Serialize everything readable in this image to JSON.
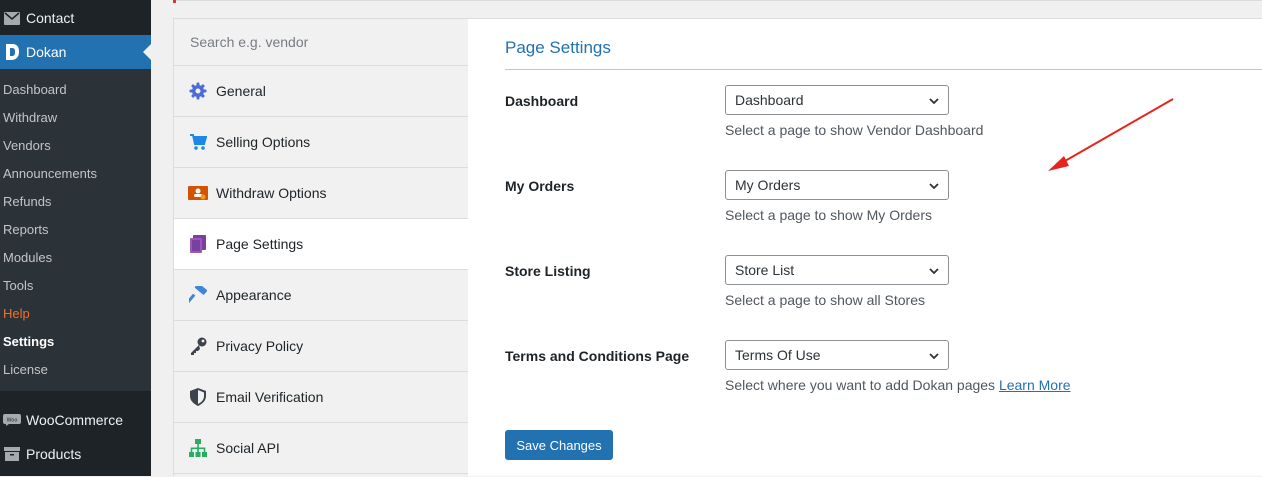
{
  "sidebar": {
    "contact": "Contact",
    "dokan": "Dokan",
    "submenu": [
      "Dashboard",
      "Withdraw",
      "Vendors",
      "Announcements",
      "Refunds",
      "Reports",
      "Modules",
      "Tools",
      "Help",
      "Settings",
      "License"
    ],
    "woocommerce": "WooCommerce",
    "products": "Products"
  },
  "tabs": {
    "search_placeholder": "Search e.g. vendor",
    "items": [
      {
        "label": "General",
        "icon": "gear-icon"
      },
      {
        "label": "Selling Options",
        "icon": "cart-icon"
      },
      {
        "label": "Withdraw Options",
        "icon": "withdraw-icon"
      },
      {
        "label": "Page Settings",
        "icon": "book-icon"
      },
      {
        "label": "Appearance",
        "icon": "hammer-icon"
      },
      {
        "label": "Privacy Policy",
        "icon": "key-icon"
      },
      {
        "label": "Email Verification",
        "icon": "shield-icon"
      },
      {
        "label": "Social API",
        "icon": "network-icon"
      }
    ],
    "active": "Page Settings"
  },
  "settings": {
    "title": "Page Settings",
    "rows": [
      {
        "label": "Dashboard",
        "value": "Dashboard",
        "desc": "Select a page to show Vendor Dashboard"
      },
      {
        "label": "My Orders",
        "value": "My Orders",
        "desc": "Select a page to show My Orders"
      },
      {
        "label": "Store Listing",
        "value": "Store List",
        "desc": "Select a page to show all Stores"
      },
      {
        "label": "Terms and Conditions Page",
        "value": "Terms Of Use",
        "desc": "Select where you want to add Dokan pages",
        "link": "Learn More"
      }
    ],
    "save_label": "Save Changes"
  },
  "colors": {
    "accent": "#2271b1",
    "annotation": "#e8231e",
    "help": "#f56e28"
  }
}
